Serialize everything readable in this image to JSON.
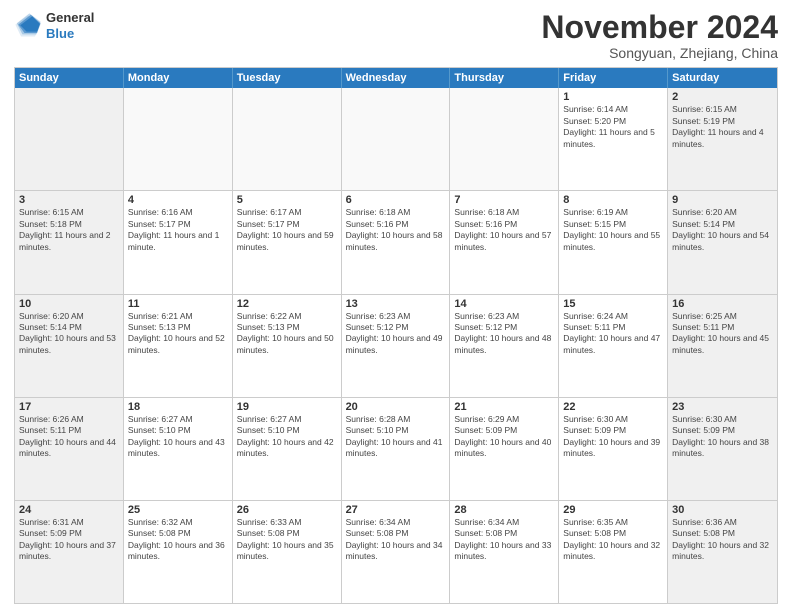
{
  "logo": {
    "general": "General",
    "blue": "Blue"
  },
  "title": "November 2024",
  "subtitle": "Songyuan, Zhejiang, China",
  "header": {
    "days": [
      "Sunday",
      "Monday",
      "Tuesday",
      "Wednesday",
      "Thursday",
      "Friday",
      "Saturday"
    ]
  },
  "weeks": [
    {
      "cells": [
        {
          "empty": true
        },
        {
          "empty": true
        },
        {
          "empty": true
        },
        {
          "empty": true
        },
        {
          "empty": true
        },
        {
          "day": "1",
          "sunrise": "6:14 AM",
          "sunset": "5:20 PM",
          "daylight": "11 hours and 5 minutes."
        },
        {
          "day": "2",
          "sunrise": "6:15 AM",
          "sunset": "5:19 PM",
          "daylight": "11 hours and 4 minutes."
        }
      ]
    },
    {
      "cells": [
        {
          "day": "3",
          "sunrise": "6:15 AM",
          "sunset": "5:18 PM",
          "daylight": "11 hours and 2 minutes."
        },
        {
          "day": "4",
          "sunrise": "6:16 AM",
          "sunset": "5:17 PM",
          "daylight": "11 hours and 1 minute."
        },
        {
          "day": "5",
          "sunrise": "6:17 AM",
          "sunset": "5:17 PM",
          "daylight": "10 hours and 59 minutes."
        },
        {
          "day": "6",
          "sunrise": "6:18 AM",
          "sunset": "5:16 PM",
          "daylight": "10 hours and 58 minutes."
        },
        {
          "day": "7",
          "sunrise": "6:18 AM",
          "sunset": "5:16 PM",
          "daylight": "10 hours and 57 minutes."
        },
        {
          "day": "8",
          "sunrise": "6:19 AM",
          "sunset": "5:15 PM",
          "daylight": "10 hours and 55 minutes."
        },
        {
          "day": "9",
          "sunrise": "6:20 AM",
          "sunset": "5:14 PM",
          "daylight": "10 hours and 54 minutes."
        }
      ]
    },
    {
      "cells": [
        {
          "day": "10",
          "sunrise": "6:20 AM",
          "sunset": "5:14 PM",
          "daylight": "10 hours and 53 minutes."
        },
        {
          "day": "11",
          "sunrise": "6:21 AM",
          "sunset": "5:13 PM",
          "daylight": "10 hours and 52 minutes."
        },
        {
          "day": "12",
          "sunrise": "6:22 AM",
          "sunset": "5:13 PM",
          "daylight": "10 hours and 50 minutes."
        },
        {
          "day": "13",
          "sunrise": "6:23 AM",
          "sunset": "5:12 PM",
          "daylight": "10 hours and 49 minutes."
        },
        {
          "day": "14",
          "sunrise": "6:23 AM",
          "sunset": "5:12 PM",
          "daylight": "10 hours and 48 minutes."
        },
        {
          "day": "15",
          "sunrise": "6:24 AM",
          "sunset": "5:11 PM",
          "daylight": "10 hours and 47 minutes."
        },
        {
          "day": "16",
          "sunrise": "6:25 AM",
          "sunset": "5:11 PM",
          "daylight": "10 hours and 45 minutes."
        }
      ]
    },
    {
      "cells": [
        {
          "day": "17",
          "sunrise": "6:26 AM",
          "sunset": "5:11 PM",
          "daylight": "10 hours and 44 minutes."
        },
        {
          "day": "18",
          "sunrise": "6:27 AM",
          "sunset": "5:10 PM",
          "daylight": "10 hours and 43 minutes."
        },
        {
          "day": "19",
          "sunrise": "6:27 AM",
          "sunset": "5:10 PM",
          "daylight": "10 hours and 42 minutes."
        },
        {
          "day": "20",
          "sunrise": "6:28 AM",
          "sunset": "5:10 PM",
          "daylight": "10 hours and 41 minutes."
        },
        {
          "day": "21",
          "sunrise": "6:29 AM",
          "sunset": "5:09 PM",
          "daylight": "10 hours and 40 minutes."
        },
        {
          "day": "22",
          "sunrise": "6:30 AM",
          "sunset": "5:09 PM",
          "daylight": "10 hours and 39 minutes."
        },
        {
          "day": "23",
          "sunrise": "6:30 AM",
          "sunset": "5:09 PM",
          "daylight": "10 hours and 38 minutes."
        }
      ]
    },
    {
      "cells": [
        {
          "day": "24",
          "sunrise": "6:31 AM",
          "sunset": "5:09 PM",
          "daylight": "10 hours and 37 minutes."
        },
        {
          "day": "25",
          "sunrise": "6:32 AM",
          "sunset": "5:08 PM",
          "daylight": "10 hours and 36 minutes."
        },
        {
          "day": "26",
          "sunrise": "6:33 AM",
          "sunset": "5:08 PM",
          "daylight": "10 hours and 35 minutes."
        },
        {
          "day": "27",
          "sunrise": "6:34 AM",
          "sunset": "5:08 PM",
          "daylight": "10 hours and 34 minutes."
        },
        {
          "day": "28",
          "sunrise": "6:34 AM",
          "sunset": "5:08 PM",
          "daylight": "10 hours and 33 minutes."
        },
        {
          "day": "29",
          "sunrise": "6:35 AM",
          "sunset": "5:08 PM",
          "daylight": "10 hours and 32 minutes."
        },
        {
          "day": "30",
          "sunrise": "6:36 AM",
          "sunset": "5:08 PM",
          "daylight": "10 hours and 32 minutes."
        }
      ]
    }
  ]
}
